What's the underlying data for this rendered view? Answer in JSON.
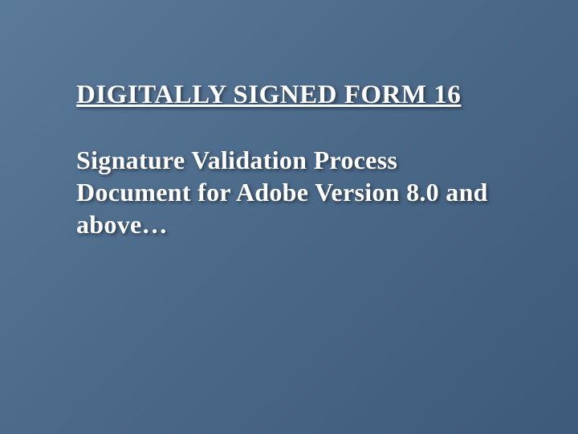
{
  "slide": {
    "title": "DIGITALLY SIGNED FORM 16",
    "subtitle": "Signature Validation Process Document for Adobe Version 8.0 and above…"
  }
}
